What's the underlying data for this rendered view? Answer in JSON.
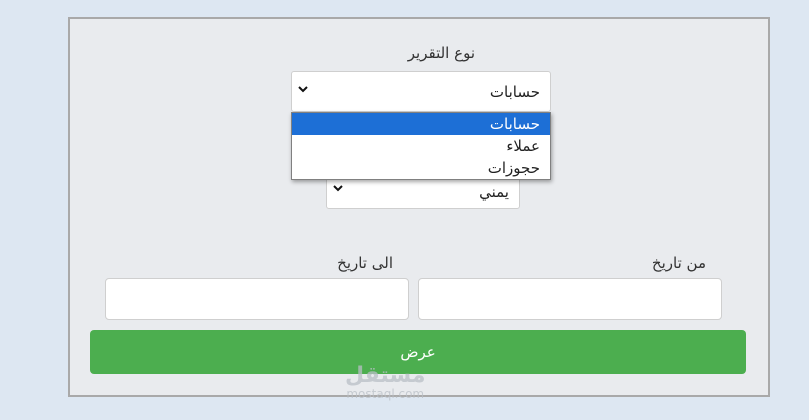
{
  "form": {
    "report_type_label": "نوع التقرير",
    "report_type_value": "حسابات",
    "report_type_options": [
      "حسابات",
      "عملاء",
      "حجوزات"
    ],
    "second_select_value": "يمني",
    "from_date_label": "من تاريخ",
    "to_date_label": "الى تاريخ",
    "from_date_value": "",
    "to_date_value": "",
    "submit_label": "عرض"
  },
  "watermark": {
    "brand": "مستقل",
    "url": "mostaql.com"
  },
  "colors": {
    "accent": "#4cae4f",
    "selected_option": "#1d6fd6",
    "panel": "#e9ebee",
    "page": "#dde7f2"
  }
}
